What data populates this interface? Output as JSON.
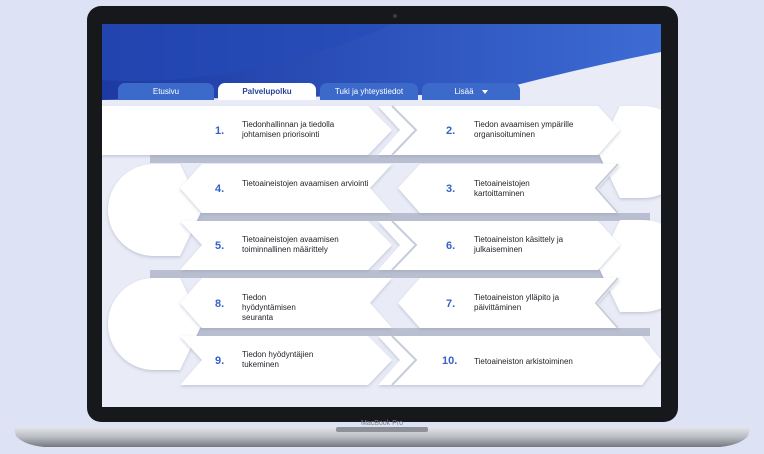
{
  "device": {
    "label": "MacBook Pro"
  },
  "nav": {
    "tabs": [
      {
        "label": "Etusivu"
      },
      {
        "label": "Palvelupolku"
      },
      {
        "label": "Tuki ja yhteystiedot"
      },
      {
        "label": "Lisää"
      }
    ],
    "active_tab": "Palvelupolku"
  },
  "steps": [
    {
      "num": "1.",
      "text": "Tiedonhallinnan ja tiedolla johtamisen priorisointi"
    },
    {
      "num": "2.",
      "text": "Tiedon avaamisen ympärille organisoituminen"
    },
    {
      "num": "3.",
      "text": "Tietoaineistojen kartoittaminen"
    },
    {
      "num": "4.",
      "text": "Tietoaineistojen avaamisen arviointi"
    },
    {
      "num": "5.",
      "text": "Tietoaineistojen avaamisen toiminnallinen määrittely"
    },
    {
      "num": "6.",
      "text": "Tietoaineiston käsittely ja julkaiseminen"
    },
    {
      "num": "7.",
      "text": "Tietoaineiston ylläpito ja päivittäminen"
    },
    {
      "num": "8.",
      "text": "Tiedon hyödyntämisen seuranta"
    },
    {
      "num": "9.",
      "text": "Tiedon hyödyntäjien tukeminen"
    },
    {
      "num": "10.",
      "text": "Tietoaineiston arkistoiminen"
    }
  ]
}
